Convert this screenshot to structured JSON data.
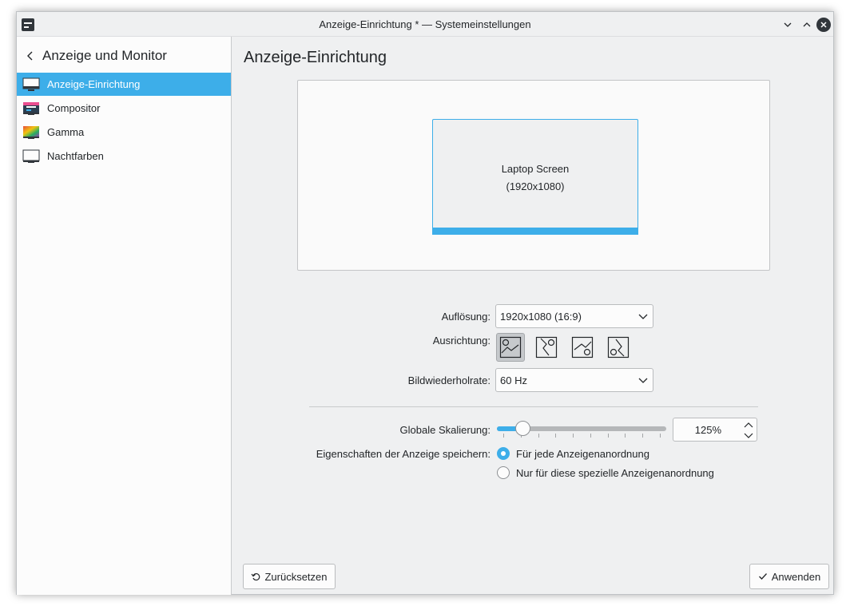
{
  "window": {
    "title": "Anzeige-Einrichtung * — Systemeinstellungen"
  },
  "sidebar": {
    "title": "Anzeige und Monitor",
    "items": [
      {
        "label": "Anzeige-Einrichtung",
        "icon": "monitor-icon",
        "active": true
      },
      {
        "label": "Compositor",
        "icon": "compositor-icon"
      },
      {
        "label": "Gamma",
        "icon": "gamma-icon"
      },
      {
        "label": "Nachtfarben",
        "icon": "night-color-icon"
      }
    ]
  },
  "main": {
    "title": "Anzeige-Einrichtung",
    "screen": {
      "name": "Laptop Screen",
      "resolution": "(1920x1080)"
    },
    "resolution": {
      "label": "Auflösung:",
      "value": "1920x1080 (16:9)"
    },
    "orientation": {
      "label": "Ausrichtung:",
      "options": [
        "landscape-icon",
        "rotate-left-icon",
        "inverted-icon",
        "rotate-right-icon"
      ],
      "selected": 0
    },
    "refresh_rate": {
      "label": "Bildwiederholrate:",
      "value": "60 Hz"
    },
    "scaling": {
      "label": "Globale Skalierung:",
      "value": "125%",
      "slider_fraction": 0.15,
      "ticks": 10
    },
    "save_properties": {
      "label": "Eigenschaften der Anzeige speichern:",
      "options": [
        {
          "label": "Für jede Anzeigenanordnung",
          "checked": true
        },
        {
          "label": "Nur für diese spezielle Anzeigenanordnung",
          "checked": false
        }
      ]
    }
  },
  "footer": {
    "reset_label": "Zurücksetzen",
    "apply_label": "Anwenden"
  },
  "colors": {
    "accent": "#3daee9",
    "window_bg": "#eff0f1",
    "text": "#232629"
  }
}
